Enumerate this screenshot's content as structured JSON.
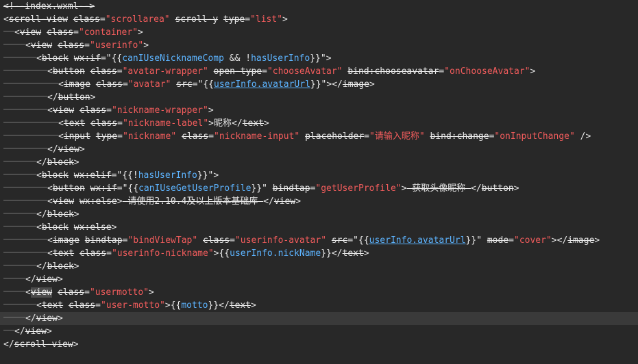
{
  "editor": {
    "lines": [
      {
        "indent": 0,
        "current": false,
        "tokens": [
          {
            "t": "comment",
            "v": "<!--index.wxml-->"
          }
        ]
      },
      {
        "indent": 0,
        "current": false,
        "tokens": [
          {
            "t": "punc",
            "v": "<"
          },
          {
            "t": "tag",
            "v": "scroll-view"
          },
          {
            "t": "text",
            "v": " "
          },
          {
            "t": "attr",
            "v": "class"
          },
          {
            "t": "eq",
            "v": "="
          },
          {
            "t": "string",
            "v": "\"scrollarea\""
          },
          {
            "t": "text",
            "v": " "
          },
          {
            "t": "attr",
            "v": "scroll-y"
          },
          {
            "t": "text",
            "v": " "
          },
          {
            "t": "attr",
            "v": "type"
          },
          {
            "t": "eq",
            "v": "="
          },
          {
            "t": "string",
            "v": "\"list\""
          },
          {
            "t": "punc",
            "v": ">"
          }
        ]
      },
      {
        "indent": 1,
        "current": false,
        "tokens": [
          {
            "t": "punc",
            "v": "<"
          },
          {
            "t": "tag",
            "v": "view"
          },
          {
            "t": "text",
            "v": " "
          },
          {
            "t": "attr",
            "v": "class"
          },
          {
            "t": "eq",
            "v": "="
          },
          {
            "t": "string",
            "v": "\"container\""
          },
          {
            "t": "punc",
            "v": ">"
          }
        ]
      },
      {
        "indent": 2,
        "current": false,
        "tokens": [
          {
            "t": "punc",
            "v": "<"
          },
          {
            "t": "tag",
            "v": "view"
          },
          {
            "t": "text",
            "v": " "
          },
          {
            "t": "attr",
            "v": "class"
          },
          {
            "t": "eq",
            "v": "="
          },
          {
            "t": "string",
            "v": "\"userinfo\""
          },
          {
            "t": "punc",
            "v": ">"
          }
        ]
      },
      {
        "indent": 3,
        "current": false,
        "tokens": [
          {
            "t": "punc",
            "v": "<"
          },
          {
            "t": "tag",
            "v": "block"
          },
          {
            "t": "text",
            "v": " "
          },
          {
            "t": "attr",
            "v": "wx:if"
          },
          {
            "t": "eq",
            "v": "="
          },
          {
            "t": "mustache",
            "v": "\"{{"
          },
          {
            "t": "expr",
            "v": "canIUseNicknameComp"
          },
          {
            "t": "op",
            "v": " && !"
          },
          {
            "t": "expr",
            "v": "hasUserInfo"
          },
          {
            "t": "mustache",
            "v": "}}\""
          },
          {
            "t": "punc",
            "v": ">"
          }
        ]
      },
      {
        "indent": 4,
        "current": false,
        "tokens": [
          {
            "t": "punc",
            "v": "<"
          },
          {
            "t": "tag",
            "v": "button"
          },
          {
            "t": "text",
            "v": " "
          },
          {
            "t": "attr",
            "v": "class"
          },
          {
            "t": "eq",
            "v": "="
          },
          {
            "t": "string",
            "v": "\"avatar-wrapper\""
          },
          {
            "t": "text",
            "v": " "
          },
          {
            "t": "attr",
            "v": "open-type"
          },
          {
            "t": "eq",
            "v": "="
          },
          {
            "t": "string",
            "v": "\"chooseAvatar\""
          },
          {
            "t": "text",
            "v": " "
          },
          {
            "t": "attr",
            "v": "bind:chooseavatar"
          },
          {
            "t": "eq",
            "v": "="
          },
          {
            "t": "string",
            "v": "\"onChooseAvatar\""
          },
          {
            "t": "punc",
            "v": ">"
          }
        ]
      },
      {
        "indent": 5,
        "current": false,
        "tokens": [
          {
            "t": "punc",
            "v": "<"
          },
          {
            "t": "tag",
            "v": "image"
          },
          {
            "t": "text",
            "v": " "
          },
          {
            "t": "attr",
            "v": "class"
          },
          {
            "t": "eq",
            "v": "="
          },
          {
            "t": "string",
            "v": "\"avatar\""
          },
          {
            "t": "text",
            "v": " "
          },
          {
            "t": "attr",
            "v": "src"
          },
          {
            "t": "eq",
            "v": "="
          },
          {
            "t": "mustache",
            "v": "\"{{"
          },
          {
            "t": "expr-u",
            "v": "userInfo.avatarUrl"
          },
          {
            "t": "mustache",
            "v": "}}\""
          },
          {
            "t": "punc",
            "v": "></"
          },
          {
            "t": "tag",
            "v": "image"
          },
          {
            "t": "punc",
            "v": ">"
          }
        ]
      },
      {
        "indent": 4,
        "current": false,
        "tokens": [
          {
            "t": "punc",
            "v": "</"
          },
          {
            "t": "tag",
            "v": "button"
          },
          {
            "t": "punc",
            "v": ">"
          }
        ]
      },
      {
        "indent": 4,
        "current": false,
        "tokens": [
          {
            "t": "punc",
            "v": "<"
          },
          {
            "t": "tag",
            "v": "view"
          },
          {
            "t": "text",
            "v": " "
          },
          {
            "t": "attr",
            "v": "class"
          },
          {
            "t": "eq",
            "v": "="
          },
          {
            "t": "string",
            "v": "\"nickname-wrapper\""
          },
          {
            "t": "punc",
            "v": ">"
          }
        ]
      },
      {
        "indent": 5,
        "current": false,
        "tokens": [
          {
            "t": "punc",
            "v": "<"
          },
          {
            "t": "tag",
            "v": "text"
          },
          {
            "t": "text",
            "v": " "
          },
          {
            "t": "attr",
            "v": "class"
          },
          {
            "t": "eq",
            "v": "="
          },
          {
            "t": "string",
            "v": "\"nickname-label\""
          },
          {
            "t": "punc",
            "v": ">"
          },
          {
            "t": "text",
            "v": "昵称"
          },
          {
            "t": "punc",
            "v": "</"
          },
          {
            "t": "tag",
            "v": "text"
          },
          {
            "t": "punc",
            "v": ">"
          }
        ]
      },
      {
        "indent": 5,
        "current": false,
        "tokens": [
          {
            "t": "punc",
            "v": "<"
          },
          {
            "t": "tag",
            "v": "input"
          },
          {
            "t": "text",
            "v": " "
          },
          {
            "t": "attr",
            "v": "type"
          },
          {
            "t": "eq",
            "v": "="
          },
          {
            "t": "string",
            "v": "\"nickname\""
          },
          {
            "t": "text",
            "v": " "
          },
          {
            "t": "attr",
            "v": "class"
          },
          {
            "t": "eq",
            "v": "="
          },
          {
            "t": "string",
            "v": "\"nickname-input\""
          },
          {
            "t": "text",
            "v": " "
          },
          {
            "t": "attr",
            "v": "placeholder"
          },
          {
            "t": "eq",
            "v": "="
          },
          {
            "t": "string",
            "v": "\"请输入昵称\""
          },
          {
            "t": "text",
            "v": " "
          },
          {
            "t": "attr",
            "v": "bind:change"
          },
          {
            "t": "eq",
            "v": "="
          },
          {
            "t": "string",
            "v": "\"onInputChange\""
          },
          {
            "t": "punc",
            "v": " />"
          }
        ]
      },
      {
        "indent": 4,
        "current": false,
        "tokens": [
          {
            "t": "punc",
            "v": "</"
          },
          {
            "t": "tag",
            "v": "view"
          },
          {
            "t": "punc",
            "v": ">"
          }
        ]
      },
      {
        "indent": 3,
        "current": false,
        "tokens": [
          {
            "t": "punc",
            "v": "</"
          },
          {
            "t": "tag",
            "v": "block"
          },
          {
            "t": "punc",
            "v": ">"
          }
        ]
      },
      {
        "indent": 3,
        "current": false,
        "tokens": [
          {
            "t": "punc",
            "v": "<"
          },
          {
            "t": "tag",
            "v": "block"
          },
          {
            "t": "text",
            "v": " "
          },
          {
            "t": "attr",
            "v": "wx:elif"
          },
          {
            "t": "eq",
            "v": "="
          },
          {
            "t": "mustache",
            "v": "\"{{!"
          },
          {
            "t": "expr",
            "v": "hasUserInfo"
          },
          {
            "t": "mustache",
            "v": "}}\""
          },
          {
            "t": "punc",
            "v": ">"
          }
        ]
      },
      {
        "indent": 4,
        "current": false,
        "tokens": [
          {
            "t": "punc",
            "v": "<"
          },
          {
            "t": "tag",
            "v": "button"
          },
          {
            "t": "text",
            "v": " "
          },
          {
            "t": "attr",
            "v": "wx:if"
          },
          {
            "t": "eq",
            "v": "="
          },
          {
            "t": "mustache",
            "v": "\"{{"
          },
          {
            "t": "expr",
            "v": "canIUseGetUserProfile"
          },
          {
            "t": "mustache",
            "v": "}}\""
          },
          {
            "t": "text",
            "v": " "
          },
          {
            "t": "attr",
            "v": "bindtap"
          },
          {
            "t": "eq",
            "v": "="
          },
          {
            "t": "string",
            "v": "\"getUserProfile\""
          },
          {
            "t": "punc",
            "v": ">"
          },
          {
            "t": "text-strike",
            "v": " 获取头像昵称 "
          },
          {
            "t": "punc",
            "v": "</"
          },
          {
            "t": "tag",
            "v": "button"
          },
          {
            "t": "punc",
            "v": ">"
          }
        ]
      },
      {
        "indent": 4,
        "current": false,
        "tokens": [
          {
            "t": "punc",
            "v": "<"
          },
          {
            "t": "tag",
            "v": "view"
          },
          {
            "t": "text",
            "v": " "
          },
          {
            "t": "attr",
            "v": "wx:else"
          },
          {
            "t": "punc",
            "v": ">"
          },
          {
            "t": "text-strike",
            "v": " 请使用2.10.4及以上版本基础库 "
          },
          {
            "t": "punc",
            "v": "</"
          },
          {
            "t": "tag",
            "v": "view"
          },
          {
            "t": "punc",
            "v": ">"
          }
        ]
      },
      {
        "indent": 3,
        "current": false,
        "tokens": [
          {
            "t": "punc",
            "v": "</"
          },
          {
            "t": "tag",
            "v": "block"
          },
          {
            "t": "punc",
            "v": ">"
          }
        ]
      },
      {
        "indent": 3,
        "current": false,
        "tokens": [
          {
            "t": "punc",
            "v": "<"
          },
          {
            "t": "tag",
            "v": "block"
          },
          {
            "t": "text",
            "v": " "
          },
          {
            "t": "attr",
            "v": "wx:else"
          },
          {
            "t": "punc",
            "v": ">"
          }
        ]
      },
      {
        "indent": 4,
        "current": false,
        "tokens": [
          {
            "t": "punc",
            "v": "<"
          },
          {
            "t": "tag",
            "v": "image"
          },
          {
            "t": "text",
            "v": " "
          },
          {
            "t": "attr",
            "v": "bindtap"
          },
          {
            "t": "eq",
            "v": "="
          },
          {
            "t": "string",
            "v": "\"bindViewTap\""
          },
          {
            "t": "text",
            "v": " "
          },
          {
            "t": "attr",
            "v": "class"
          },
          {
            "t": "eq",
            "v": "="
          },
          {
            "t": "string",
            "v": "\"userinfo-avatar\""
          },
          {
            "t": "text",
            "v": " "
          },
          {
            "t": "attr",
            "v": "src"
          },
          {
            "t": "eq",
            "v": "="
          },
          {
            "t": "mustache",
            "v": "\"{{"
          },
          {
            "t": "expr-u",
            "v": "userInfo.avatarUrl"
          },
          {
            "t": "mustache",
            "v": "}}\""
          },
          {
            "t": "text",
            "v": " "
          },
          {
            "t": "attr",
            "v": "mode"
          },
          {
            "t": "eq",
            "v": "="
          },
          {
            "t": "string",
            "v": "\"cover\""
          },
          {
            "t": "punc",
            "v": "></"
          },
          {
            "t": "tag",
            "v": "image"
          },
          {
            "t": "punc",
            "v": ">"
          }
        ]
      },
      {
        "indent": 4,
        "current": false,
        "tokens": [
          {
            "t": "punc",
            "v": "<"
          },
          {
            "t": "tag",
            "v": "text"
          },
          {
            "t": "text",
            "v": " "
          },
          {
            "t": "attr",
            "v": "class"
          },
          {
            "t": "eq",
            "v": "="
          },
          {
            "t": "string",
            "v": "\"userinfo-nickname\""
          },
          {
            "t": "punc",
            "v": ">"
          },
          {
            "t": "mustache",
            "v": "{{"
          },
          {
            "t": "expr",
            "v": "userInfo.nickName"
          },
          {
            "t": "mustache",
            "v": "}}"
          },
          {
            "t": "punc",
            "v": "</"
          },
          {
            "t": "tag",
            "v": "text"
          },
          {
            "t": "punc",
            "v": ">"
          }
        ]
      },
      {
        "indent": 3,
        "current": false,
        "tokens": [
          {
            "t": "punc",
            "v": "</"
          },
          {
            "t": "tag",
            "v": "block"
          },
          {
            "t": "punc",
            "v": ">"
          }
        ]
      },
      {
        "indent": 2,
        "current": false,
        "tokens": [
          {
            "t": "punc",
            "v": "</"
          },
          {
            "t": "tag",
            "v": "view"
          },
          {
            "t": "punc",
            "v": ">"
          }
        ]
      },
      {
        "indent": 2,
        "current": false,
        "tokens": [
          {
            "t": "punc",
            "v": "<"
          },
          {
            "t": "tag-cur",
            "v": "view"
          },
          {
            "t": "text",
            "v": " "
          },
          {
            "t": "attr",
            "v": "class"
          },
          {
            "t": "eq",
            "v": "="
          },
          {
            "t": "string",
            "v": "\"usermotto\""
          },
          {
            "t": "punc",
            "v": ">"
          }
        ]
      },
      {
        "indent": 3,
        "current": false,
        "tokens": [
          {
            "t": "punc",
            "v": "<"
          },
          {
            "t": "tag",
            "v": "text"
          },
          {
            "t": "text",
            "v": " "
          },
          {
            "t": "attr",
            "v": "class"
          },
          {
            "t": "eq",
            "v": "="
          },
          {
            "t": "string",
            "v": "\"user-motto\""
          },
          {
            "t": "punc",
            "v": ">"
          },
          {
            "t": "mustache",
            "v": "{{"
          },
          {
            "t": "expr",
            "v": "motto"
          },
          {
            "t": "mustache",
            "v": "}}"
          },
          {
            "t": "punc",
            "v": "</"
          },
          {
            "t": "tag",
            "v": "text"
          },
          {
            "t": "punc",
            "v": ">"
          }
        ]
      },
      {
        "indent": 2,
        "current": true,
        "tokens": [
          {
            "t": "punc",
            "v": "</"
          },
          {
            "t": "tag",
            "v": "view"
          },
          {
            "t": "punc",
            "v": ">"
          }
        ]
      },
      {
        "indent": 1,
        "current": false,
        "tokens": [
          {
            "t": "punc",
            "v": "</"
          },
          {
            "t": "tag",
            "v": "view"
          },
          {
            "t": "punc",
            "v": ">"
          }
        ]
      },
      {
        "indent": 0,
        "current": false,
        "tokens": [
          {
            "t": "punc",
            "v": "</"
          },
          {
            "t": "tag",
            "v": "scroll-view"
          },
          {
            "t": "punc",
            "v": ">"
          }
        ]
      }
    ]
  },
  "colors": {
    "background": "#282828",
    "current_line": "#3a3a3a",
    "string": "#f15c5c",
    "expression": "#5db4ff",
    "text": "#e6e6e6"
  }
}
